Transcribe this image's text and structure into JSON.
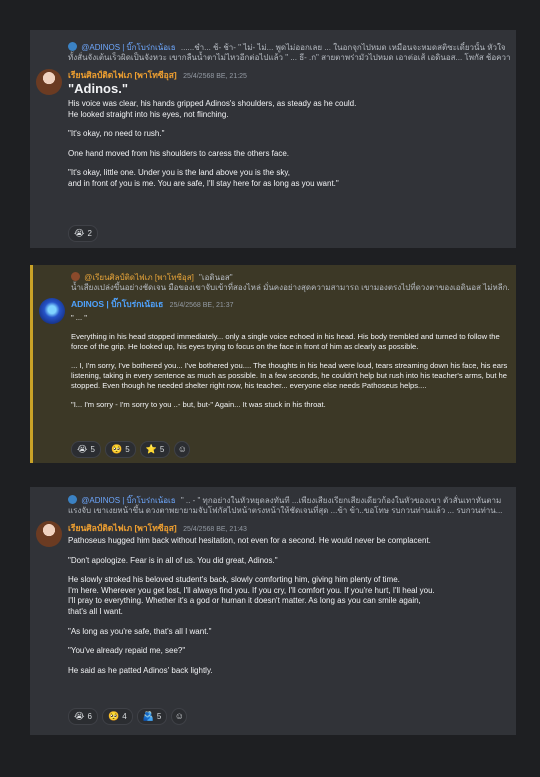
{
  "block1": {
    "reply_name": "@ADINOS | บิ๊กโบร่กเน้อเธ",
    "reply_text": "......ชำ... ช้- ช้า-  \" ไม่- ไม่... พูดไม่ออกเลย ... ในอกจุกไปหมด เหมือนจะหมดสติซะเดี๋ยวนั้น หัวใจ",
    "reply_text2": "ทั้งสั่นจังเต้นเร็วผิดเป็นจังหวะ เขากลืนน้ำตาไม่ไหวอีกต่อไปแล้ว \" ... ธี- .ก\" สายตาพร่ามัวไปหมด เอาต่อเส้ เอดินอส... โพกัส ช้อความ...",
    "author": "เรียนศิลป์ติดไฟเภ [พาโทซีอุส]",
    "timestamp": "25/4/2568 BE, 21:25",
    "lines": [
      "\"Adinos.\"",
      "His voice was clear, his hands gripped Adinos's shoulders, as steady as he could.",
      "He looked straight into his eyes, not flinching.",
      "\"It's okay, no need to rush.\"",
      "One hand moved from his shoulders to caress the others face.",
      "\"It's okay, little one. Under you is the land above you is the sky,",
      "and in front of you is me. You are safe, I'll stay here for as long as you want.\""
    ],
    "reactions": [
      {
        "icon": "😭",
        "count": "2"
      }
    ]
  },
  "block2": {
    "reply_name": "@เรียนศิลป์ติดไฟเภ [พาโทซีอุส]",
    "reply_text": "\"เอดินอส\"",
    "reply_text2": "น้ำเสียงเปล่งขึ้นอย่างชัดเจน มือของเขาจับเข้าที่สองไหล่ มั่นคงอย่างสุดความสามารถ เขามองตรงไปที่ดวงตาของเอดินอส ไม่หลีก...",
    "author": "ADINOS | บิ๊กโบร่กเน้อเธ",
    "timestamp": "25/4/2568 BE, 21:37",
    "lines": [
      "\" ... \"",
      "Everything in his head stopped immediately... only a single voice echoed in his head. His body trembled and turned to follow the force of the grip. He looked up, his eyes trying to focus on the face in front of him as clearly as possible.",
      "... I, I'm sorry, I've bothered you... I've bothered you.... The thoughts in his head were loud, tears streaming down his face, his ears listening, taking in every sentence as much as possible. In a few seconds, he couldn't help but rush into his teacher's arms, but he stopped. Even though he needed shelter right now, his teacher... everyone else  needs Pathoseus helps....",
      "\"I... I'm sorry - I'm sorry to you ..- but, but-\" Again... It was stuck in his throat."
    ],
    "reactions": [
      {
        "icon": "😭",
        "count": "5"
      },
      {
        "icon": "🥺",
        "count": "5"
      },
      {
        "icon": "⭐",
        "count": "5"
      }
    ]
  },
  "block3": {
    "reply_name": "@ADINOS | บิ๊กโบร่กเน้อเธ",
    "reply_text": "\" .. - \" ทุกอย่างในหัวหยุดลงทันที ...เพียงเสียงเรียกเสียงเดียวก้องในหัวของเขา ตัวสั่นเทาหันตาม",
    "reply_text2": "แรงจับ เขาเงยหน้าขึ้น ดวงตาพยายามจับโฟกัสไปหน้าตรงหน้าให้ชัดเจนที่สุด ...ข้า ข้า..ขอโทษ รบกวนท่านแล้ว ... รบกวนท่าน...",
    "author": "เรียนศิลป์ติดไฟเภ [พาโทซีอุส]",
    "timestamp": "25/4/2568 BE, 21:43",
    "lines": [
      "Pathoseus hugged him back without hesitation, not even for a second. He would never be complacent.",
      "\"Don't apologize. Fear is in all of us. You did great, Adinos.\"",
      "He slowly stroked his beloved student's back, slowly comforting him, giving him plenty of time.",
      "I'm here. Wherever you get lost, I'll always find you. If you cry, I'll comfort you. If you're hurt, I'll heal you.",
      "I'll pray to everything. Whether it's a god or human it doesn't matter. As long as you can smile again,",
      "that's all I want.",
      "\"As long as you're safe, that's all I want.\"",
      "\"You've already repaid me, see?\"",
      "He said as he patted Adinos' back lightly."
    ],
    "reactions": [
      {
        "icon": "😭",
        "count": "6"
      },
      {
        "icon": "🥺",
        "count": "4"
      },
      {
        "icon": "🫂",
        "count": "5"
      }
    ]
  },
  "icons": {
    "add_reaction": "add-reaction-icon"
  }
}
